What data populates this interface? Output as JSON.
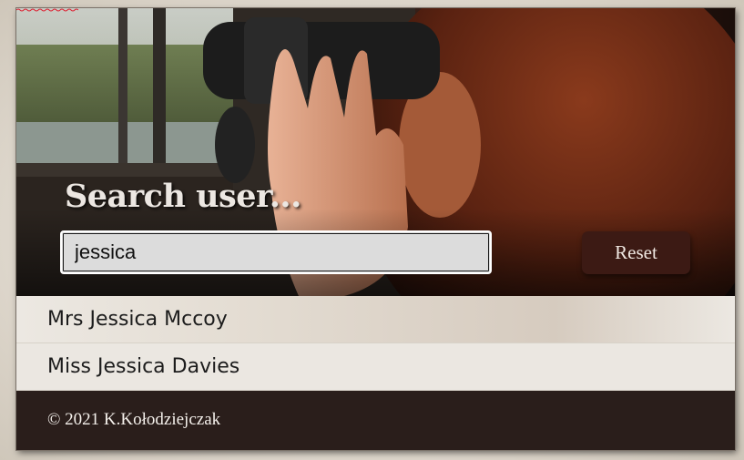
{
  "search": {
    "title": "Search user...",
    "value": "jessica",
    "reset_label": "Reset"
  },
  "results": [
    {
      "name": "Mrs Jessica Mccoy"
    },
    {
      "name": "Miss Jessica Davies"
    }
  ],
  "footer": {
    "copyright": "© 2021 K.Kołodziejczak"
  },
  "colors": {
    "reset_button": "#3c1a14",
    "footer_background": "#2a1e1b",
    "result_background": "#ebe7e1"
  },
  "hero_image": {
    "icon": "woman-with-binoculars-photo"
  }
}
